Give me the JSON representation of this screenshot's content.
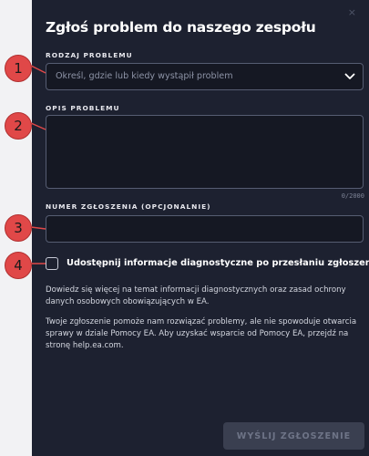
{
  "dialog": {
    "close_icon": "×",
    "title": "Zgłoś problem do naszego zespołu"
  },
  "problem_type": {
    "label": "RODZAJ PROBLEMU",
    "placeholder": "Określ, gdzie lub kiedy wystąpił problem",
    "icon": "chevron-down-icon"
  },
  "description": {
    "label": "OPIS PROBLEMU",
    "value": "",
    "counter": "0/2000"
  },
  "ticket_number": {
    "label": "NUMER ZGŁOSZENIA (OPCJONALNIE)",
    "value": ""
  },
  "diagnostics": {
    "checked": false,
    "label": "Udostępnij informacje diagnostyczne po przesłaniu zgłoszenia"
  },
  "info": {
    "paragraph1": "Dowiedz się więcej na temat informacji diagnostycznych oraz zasad ochrony danych osobowych obowiązujących w EA.",
    "paragraph2": "Twoje zgłoszenie pomoże nam rozwiązać problemy, ale nie spowoduje otwarcia sprawy w dziale Pomocy EA. Aby uzyskać wsparcie od Pomocy EA, przejdź na stronę help.ea.com."
  },
  "submit": {
    "label": "WYŚLIJ ZGŁOSZENIE",
    "enabled": false
  },
  "callouts": [
    "1",
    "2",
    "3",
    "4"
  ],
  "colors": {
    "dialog_bg": "#1d2130",
    "field_bg": "#151823",
    "callout": "#e04848",
    "submit_disabled": "#3a3f50"
  }
}
